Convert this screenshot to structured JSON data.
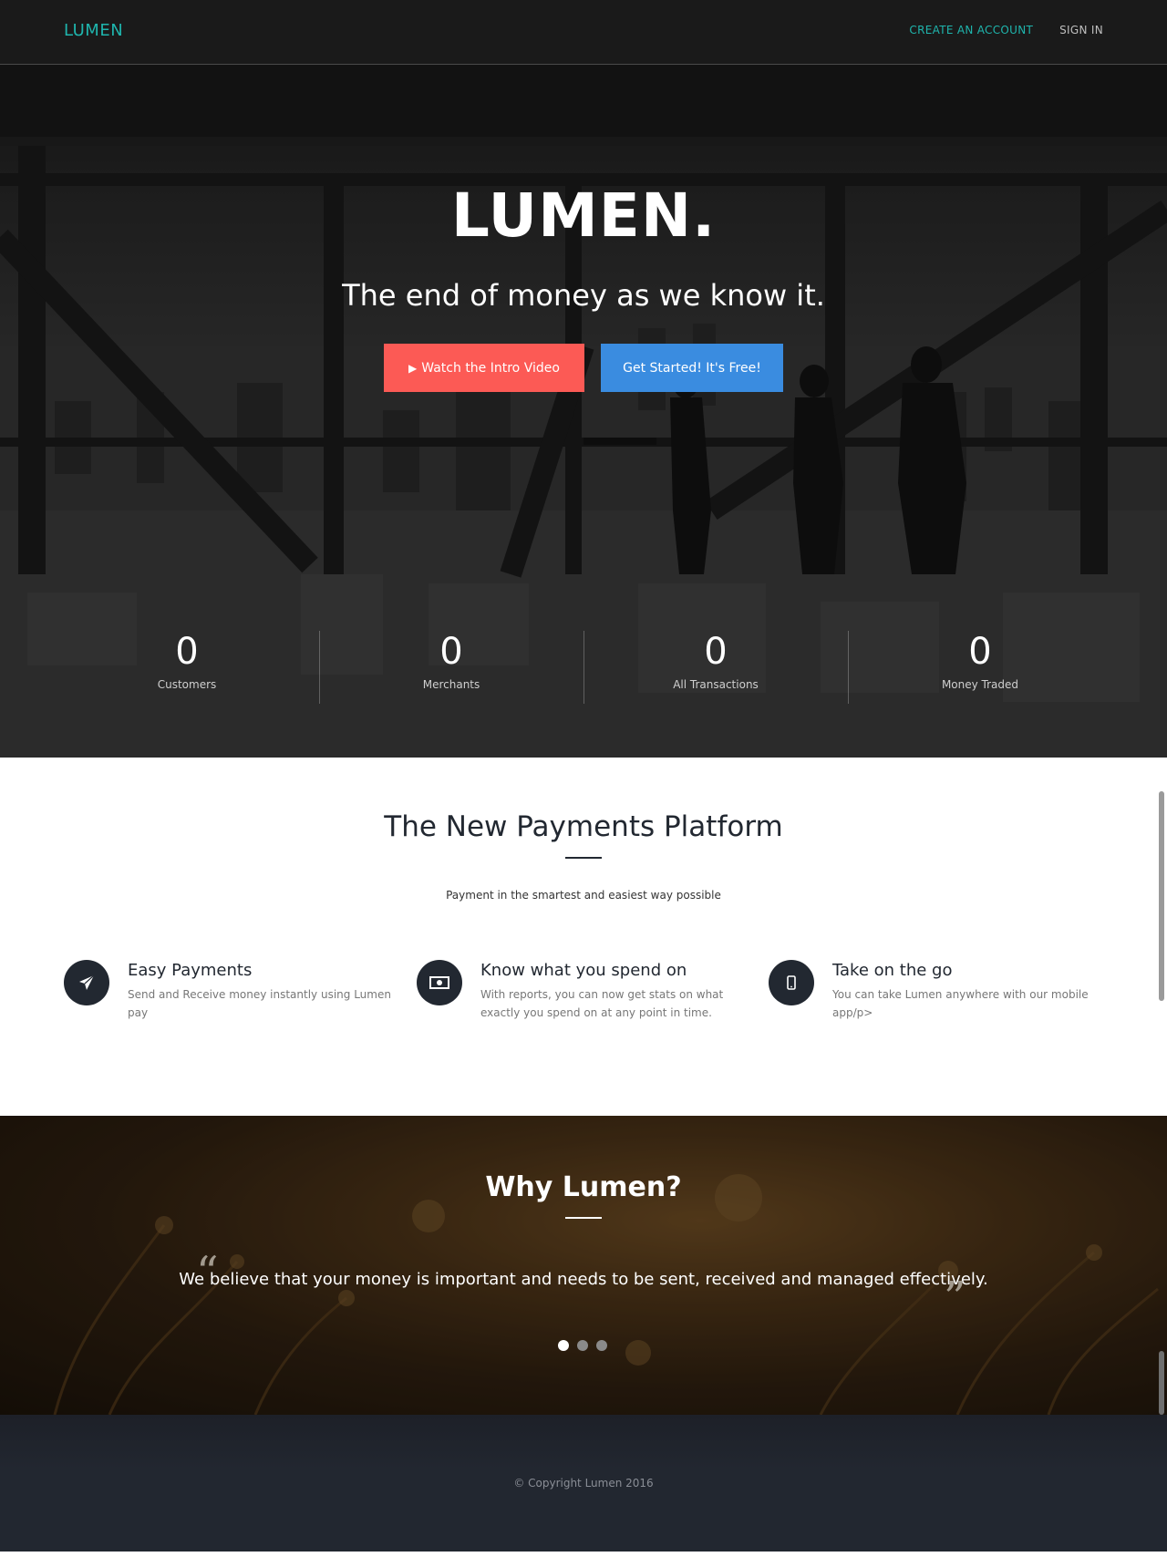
{
  "colors": {
    "brand": "#1fb5ad",
    "primary_button": "#fc5a55",
    "secondary_button": "#3a8ce0",
    "dark": "#222831"
  },
  "nav": {
    "logo": "LUMEN",
    "links": [
      {
        "label": "CREATE AN ACCOUNT"
      },
      {
        "label": "SIGN IN"
      }
    ]
  },
  "hero": {
    "title": "LUMEN.",
    "subtitle": "The end of money as we know it.",
    "watch_button": "Watch the Intro Video",
    "watch_icon": "play-icon",
    "start_button": "Get Started! It's Free!"
  },
  "stats": [
    {
      "value": "0",
      "label": "Customers"
    },
    {
      "value": "0",
      "label": "Merchants"
    },
    {
      "value": "0",
      "label": "All Transactions"
    },
    {
      "value": "0",
      "label": "Money Traded"
    }
  ],
  "features": {
    "title": "The New Payments Platform",
    "subtitle": "Payment in the smartest and easiest way possible",
    "items": [
      {
        "icon": "paper-plane-icon",
        "title": "Easy Payments",
        "description": "Send and Receive money instantly using Lumen pay"
      },
      {
        "icon": "money-icon",
        "title": "Know what you spend on",
        "description": "With reports, you can now get stats on what exactly you spend on at any point in time."
      },
      {
        "icon": "mobile-icon",
        "title": "Take on the go",
        "description": "You can take Lumen anywhere with our mobile app/p>"
      }
    ]
  },
  "testimonial": {
    "title": "Why Lumen?",
    "quote": "We believe that your money is important and needs to be sent, received and managed effectively.",
    "open_quote_mark": "“",
    "close_quote_mark": "”",
    "slides": 3,
    "active_slide": 0
  },
  "footer": {
    "copyright": "© Copyright Lumen 2016"
  }
}
